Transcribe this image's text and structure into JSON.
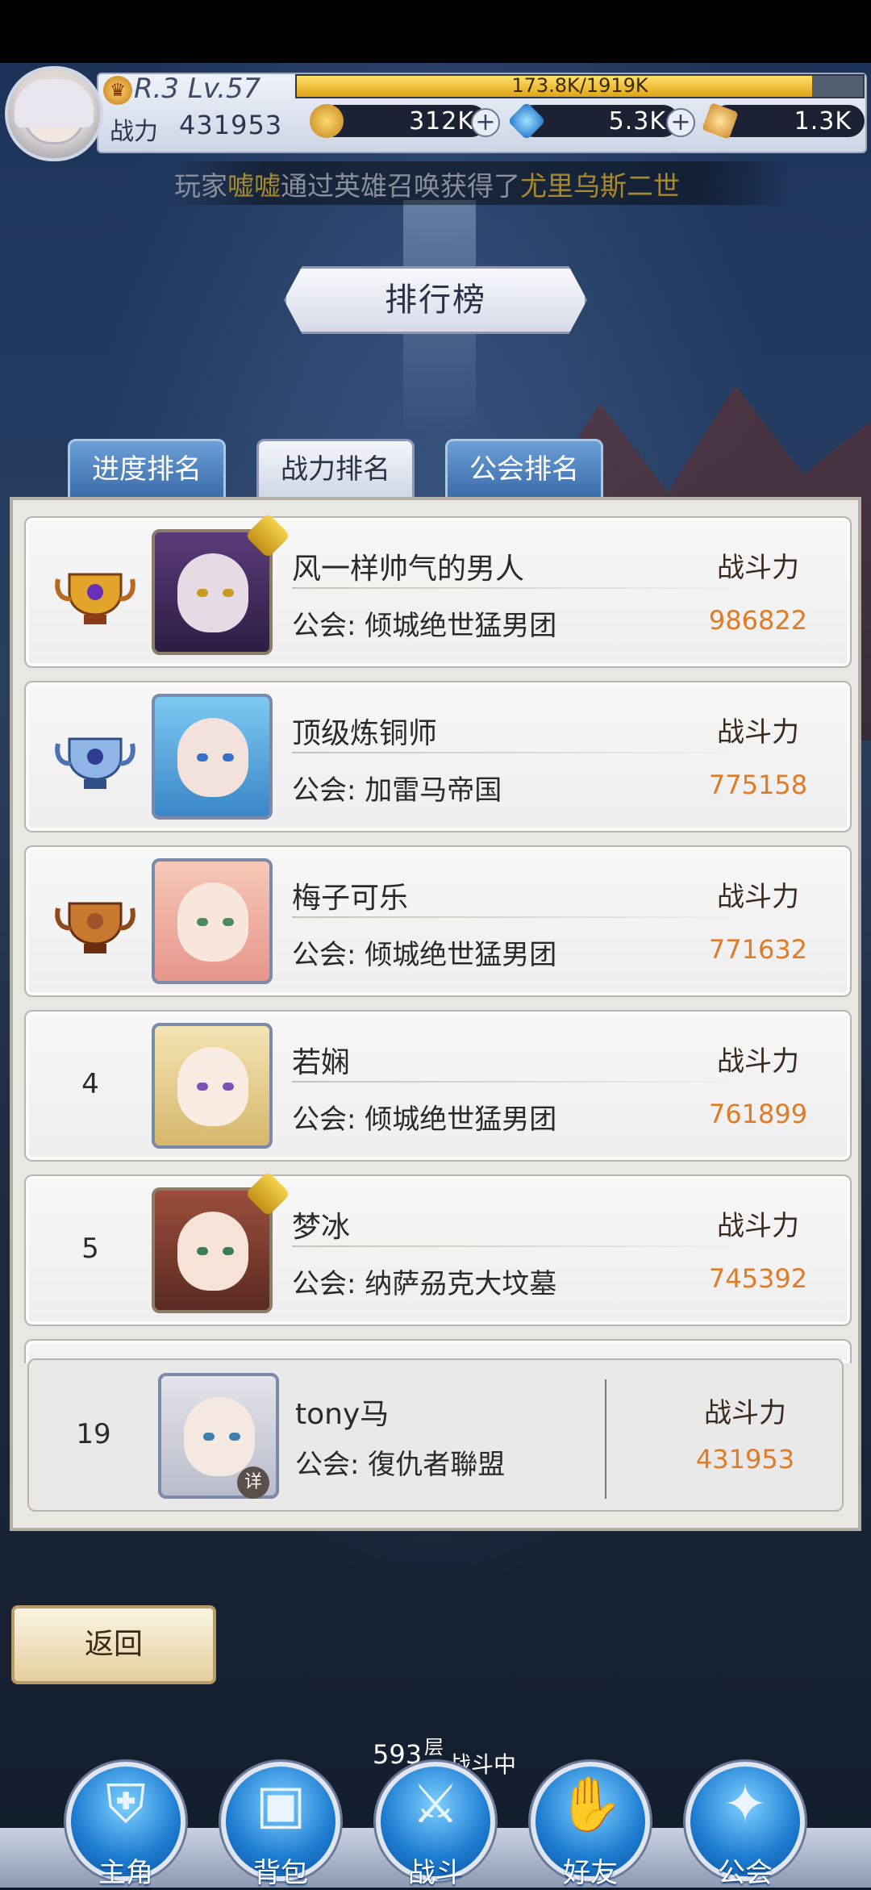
{
  "hud": {
    "level": "R.3 Lv.57",
    "power_label": "战力",
    "power_value": "431953",
    "exp_text": "173.8K/1919K",
    "exp_fraction": 0.91,
    "gold": "312K",
    "diamond": "5.3K",
    "ticket": "1.3K"
  },
  "marquee": {
    "prefix": "玩家",
    "player": "嘘嘘",
    "middle": "通过英雄召唤获得了",
    "hero": "尤里乌斯二世"
  },
  "title": "排行榜",
  "tabs": [
    {
      "label": "进度排名",
      "active": false
    },
    {
      "label": "战力排名",
      "active": true
    },
    {
      "label": "公会排名",
      "active": false
    }
  ],
  "power_header": "战斗力",
  "rankings": [
    {
      "rank": "",
      "trophy": "gold-trophy-icon",
      "name": "风一样帅气的男人",
      "guild": "公会: 倾城绝世猛男团",
      "power": "986822"
    },
    {
      "rank": "",
      "trophy": "silver-trophy-icon",
      "name": "顶级炼铜师",
      "guild": "公会: 加雷马帝国",
      "power": "775158"
    },
    {
      "rank": "",
      "trophy": "bronze-trophy-icon",
      "name": "梅子可乐",
      "guild": "公会: 倾城绝世猛男团",
      "power": "771632"
    },
    {
      "rank": "4",
      "trophy": "",
      "name": "若娴",
      "guild": "公会: 倾城绝世猛男团",
      "power": "761899"
    },
    {
      "rank": "5",
      "trophy": "",
      "name": "梦冰",
      "guild": "公会: 纳萨刕克大坟墓",
      "power": "745392"
    }
  ],
  "self": {
    "rank": "19",
    "name": "tony马",
    "guild": "公会: 復仇者聯盟",
    "power": "431953",
    "detail_badge": "详"
  },
  "back_label": "返回",
  "battle": {
    "floor": "593",
    "floor_unit": "层",
    "state": "战斗中"
  },
  "nav": [
    {
      "label": "主角",
      "icon": "hero-helmet-icon"
    },
    {
      "label": "背包",
      "icon": "backpack-icon"
    },
    {
      "label": "战斗",
      "icon": "crossed-swords-icon"
    },
    {
      "label": "好友",
      "icon": "handshake-icon"
    },
    {
      "label": "公会",
      "icon": "guild-crest-icon"
    }
  ],
  "colors": {
    "power_value": "#e07b27",
    "tab_inactive": "#3a6ca9",
    "nav_blue": "#1c7bd0"
  }
}
